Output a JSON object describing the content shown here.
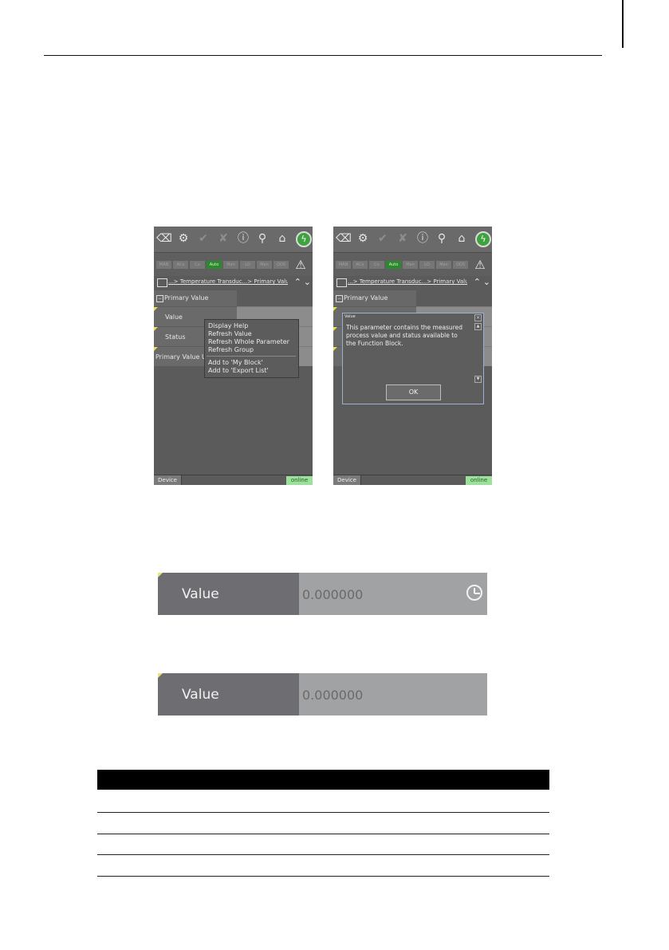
{
  "screen1": {
    "breadcrumb": "...> Temperature Transduc...> Primary Value",
    "tree": {
      "header": "Primary Value",
      "items": [
        "Value",
        "Status",
        "Primary Value U..."
      ]
    },
    "context_menu": {
      "group1": [
        "Display Help",
        "Refresh Value",
        "Refresh Whole Parameter",
        "Refresh Group"
      ],
      "group2": [
        "Add to 'My Block'",
        "Add to 'Export List'"
      ]
    },
    "footer": {
      "tab": "Device",
      "status": "online"
    }
  },
  "screen2": {
    "breadcrumb": "...> Temperature Transduc...> Primary Value",
    "tree": {
      "header": "Primary Value"
    },
    "dialog": {
      "title": "Value",
      "text": "This parameter contains the measured process value and status available to the Function Block.",
      "ok_label": "OK"
    },
    "footer": {
      "tab": "Device",
      "status": "online"
    }
  },
  "mode_strip": [
    "MAN",
    "ACo",
    "Co",
    "Auto",
    "Man",
    "LO",
    "Man",
    "OOS"
  ],
  "value_row_1": {
    "label": "Value",
    "value": "0.000000"
  },
  "value_row_2": {
    "label": "Value",
    "value": "0.000000"
  }
}
